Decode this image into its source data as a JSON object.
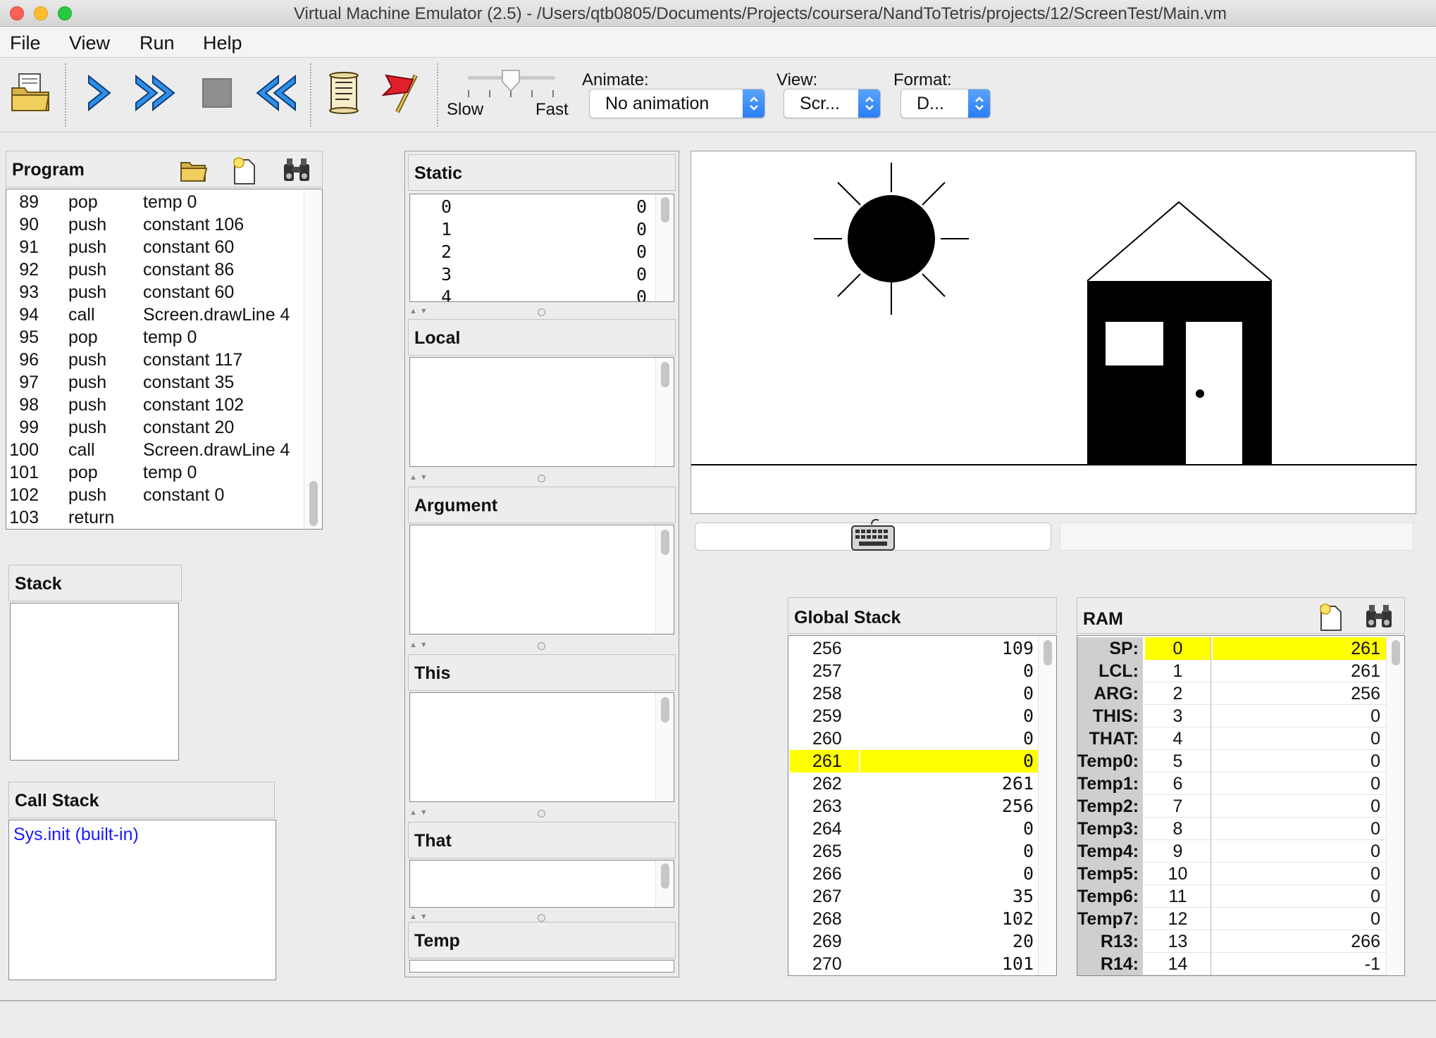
{
  "window": {
    "title": "Virtual Machine Emulator (2.5) - /Users/qtb0805/Documents/Projects/coursera/NandToTetris/projects/12/ScreenTest/Main.vm"
  },
  "menu": {
    "file": "File",
    "view": "View",
    "run": "Run",
    "help": "Help"
  },
  "toolbar": {
    "speed_slow": "Slow",
    "speed_fast": "Fast",
    "animate_label": "Animate:",
    "animate_value": "No animation",
    "view_label": "View:",
    "view_value": "Scr...",
    "format_label": "Format:",
    "format_value": "D..."
  },
  "program": {
    "title": "Program",
    "rows": [
      {
        "line": "89",
        "op": "pop",
        "arg": "temp 0"
      },
      {
        "line": "90",
        "op": "push",
        "arg": "constant 106"
      },
      {
        "line": "91",
        "op": "push",
        "arg": "constant 60"
      },
      {
        "line": "92",
        "op": "push",
        "arg": "constant 86"
      },
      {
        "line": "93",
        "op": "push",
        "arg": "constant 60"
      },
      {
        "line": "94",
        "op": "call",
        "arg": "Screen.drawLine 4"
      },
      {
        "line": "95",
        "op": "pop",
        "arg": "temp 0"
      },
      {
        "line": "96",
        "op": "push",
        "arg": "constant 117"
      },
      {
        "line": "97",
        "op": "push",
        "arg": "constant 35"
      },
      {
        "line": "98",
        "op": "push",
        "arg": "constant 102"
      },
      {
        "line": "99",
        "op": "push",
        "arg": "constant 20"
      },
      {
        "line": "100",
        "op": "call",
        "arg": "Screen.drawLine 4"
      },
      {
        "line": "101",
        "op": "pop",
        "arg": "temp 0"
      },
      {
        "line": "102",
        "op": "push",
        "arg": "constant 0"
      },
      {
        "line": "103",
        "op": "return",
        "arg": ""
      }
    ]
  },
  "stack": {
    "title": "Stack"
  },
  "call_stack": {
    "title": "Call Stack",
    "items": [
      "Sys.init (built-in)"
    ]
  },
  "segments": {
    "static": {
      "title": "Static",
      "rows": [
        {
          "idx": "0",
          "val": "0"
        },
        {
          "idx": "1",
          "val": "0"
        },
        {
          "idx": "2",
          "val": "0"
        },
        {
          "idx": "3",
          "val": "0"
        },
        {
          "idx": "4",
          "val": "0"
        }
      ]
    },
    "local": {
      "title": "Local"
    },
    "argument": {
      "title": "Argument"
    },
    "this": {
      "title": "This"
    },
    "that": {
      "title": "That"
    },
    "temp": {
      "title": "Temp"
    }
  },
  "global_stack": {
    "title": "Global Stack",
    "rows": [
      {
        "addr": "256",
        "val": "109"
      },
      {
        "addr": "257",
        "val": "0"
      },
      {
        "addr": "258",
        "val": "0"
      },
      {
        "addr": "259",
        "val": "0"
      },
      {
        "addr": "260",
        "val": "0"
      },
      {
        "addr": "261",
        "val": "0"
      },
      {
        "addr": "262",
        "val": "261"
      },
      {
        "addr": "263",
        "val": "256"
      },
      {
        "addr": "264",
        "val": "0"
      },
      {
        "addr": "265",
        "val": "0"
      },
      {
        "addr": "266",
        "val": "0"
      },
      {
        "addr": "267",
        "val": "35"
      },
      {
        "addr": "268",
        "val": "102"
      },
      {
        "addr": "269",
        "val": "20"
      },
      {
        "addr": "270",
        "val": "101"
      }
    ],
    "highlight_index": 5
  },
  "ram": {
    "title": "RAM",
    "rows": [
      {
        "label": "SP:",
        "addr": "0",
        "val": "261"
      },
      {
        "label": "LCL:",
        "addr": "1",
        "val": "261"
      },
      {
        "label": "ARG:",
        "addr": "2",
        "val": "256"
      },
      {
        "label": "THIS:",
        "addr": "3",
        "val": "0"
      },
      {
        "label": "THAT:",
        "addr": "4",
        "val": "0"
      },
      {
        "label": "Temp0:",
        "addr": "5",
        "val": "0"
      },
      {
        "label": "Temp1:",
        "addr": "6",
        "val": "0"
      },
      {
        "label": "Temp2:",
        "addr": "7",
        "val": "0"
      },
      {
        "label": "Temp3:",
        "addr": "8",
        "val": "0"
      },
      {
        "label": "Temp4:",
        "addr": "9",
        "val": "0"
      },
      {
        "label": "Temp5:",
        "addr": "10",
        "val": "0"
      },
      {
        "label": "Temp6:",
        "addr": "11",
        "val": "0"
      },
      {
        "label": "Temp7:",
        "addr": "12",
        "val": "0"
      },
      {
        "label": "R13:",
        "addr": "13",
        "val": "266"
      },
      {
        "label": "R14:",
        "addr": "14",
        "val": "-1"
      }
    ],
    "highlight_index": 0
  },
  "colors": {
    "highlight": "#ffff00",
    "call_stack_text": "#1a1aff",
    "toolbar_arrow_blue": "#2f8fe6"
  },
  "icons": {
    "load": "load-program-icon",
    "step": "single-step-icon",
    "run": "run-icon",
    "stop": "stop-icon",
    "reset": "reset-icon",
    "script": "script-icon",
    "breakpoint": "breakpoint-icon",
    "folder": "folder-icon",
    "new_file": "new-file-icon",
    "find": "binoculars-icon",
    "keyboard": "keyboard-icon"
  }
}
